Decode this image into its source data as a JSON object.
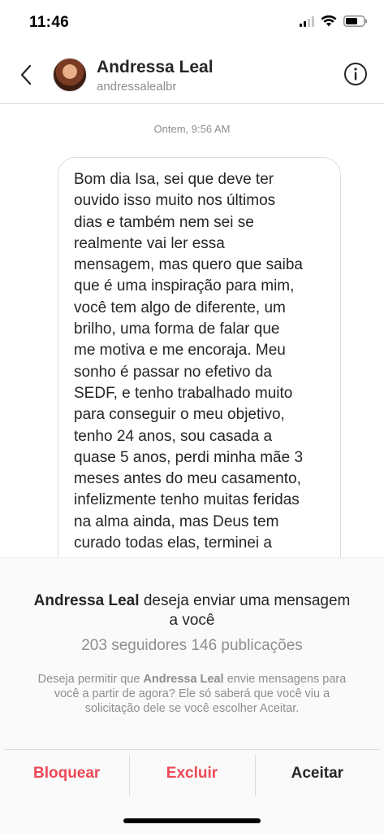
{
  "status_bar": {
    "time": "11:46",
    "icons": [
      "signal-icon",
      "wifi-icon",
      "battery-icon"
    ]
  },
  "header": {
    "back_icon": "chevron-left-icon",
    "name": "Andressa Leal",
    "username": "andressalealbr",
    "info_icon": "info-icon"
  },
  "conversation": {
    "timestamp": "Ontem, 9:56 AM",
    "message": "Bom dia Isa, sei que deve ter\nouvido isso muito nos últimos\ndias e também nem sei se\nrealmente vai ler essa\nmensagem, mas quero que saiba\nque é uma inspiração para mim,\nvocê tem algo de diferente, um\nbrilho, uma forma de falar que\nme motiva e me encoraja. Meu\nsonho é passar no efetivo da\nSEDF, e tenho trabalhado muito\npara conseguir o meu objetivo,\ntenho 24 anos, sou casada a\nquase 5 anos, perdi minha mãe 3\nmeses antes do meu casamento,\ninfelizmente tenho muitas feridas\nna alma ainda, mas Deus tem\ncurado todas elas, terminei a\nfaculdade..."
  },
  "request": {
    "name": "Andressa Leal",
    "title_rest": " deseja enviar uma mensagem a você",
    "stats": "203 seguidores 146 publicações",
    "note_prefix": "Deseja permitir que ",
    "note_name": "Andressa Leal",
    "note_suffix": " envie mensagens para você a partir de agora? Ele só saberá que você viu a solicitação dele se você escolher Aceitar."
  },
  "actions": {
    "block": "Bloquear",
    "delete": "Excluir",
    "accept": "Aceitar"
  },
  "colors": {
    "destructive": "#ed4956",
    "text": "#262626",
    "secondary": "#8e8e8e",
    "border": "#dbdbdb",
    "panel": "#fafafa"
  }
}
